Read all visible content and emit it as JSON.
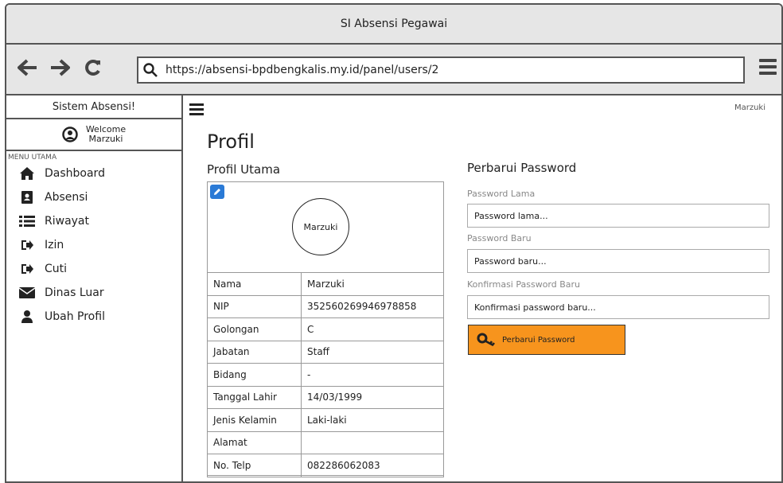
{
  "window": {
    "title": "SI Absensi Pegawai"
  },
  "browser": {
    "url": "https://absensi-bpdbengkalis.my.id/panel/users/2",
    "back_icon": "arrow-left-icon",
    "forward_icon": "arrow-right-icon",
    "reload_icon": "reload-icon",
    "search_icon": "search-icon",
    "menu_icon": "menu-icon"
  },
  "sidebar": {
    "app_name": "Sistem Absensi!",
    "welcome_line1": "Welcome",
    "welcome_line2": "Marzuki",
    "caption": "MENU UTAMA",
    "items": [
      {
        "label": "Dashboard",
        "icon": "home-icon"
      },
      {
        "label": "Absensi",
        "icon": "address-book-icon"
      },
      {
        "label": "Riwayat",
        "icon": "list-icon"
      },
      {
        "label": "Izin",
        "icon": "sign-in-icon"
      },
      {
        "label": "Cuti",
        "icon": "sign-in-icon"
      },
      {
        "label": "Dinas Luar",
        "icon": "envelope-icon"
      },
      {
        "label": "Ubah Profil",
        "icon": "user-icon"
      }
    ]
  },
  "header": {
    "user_name": "Marzuki"
  },
  "profile": {
    "page_title": "Profil",
    "section_title": "Profil Utama",
    "avatar_text": "Marzuki",
    "rows": [
      {
        "key": "Nama",
        "value": "Marzuki"
      },
      {
        "key": "NIP",
        "value": "352560269946978858"
      },
      {
        "key": "Golongan",
        "value": "C"
      },
      {
        "key": "Jabatan",
        "value": "Staff"
      },
      {
        "key": "Bidang",
        "value": "-"
      },
      {
        "key": "Tanggal Lahir",
        "value": "14/03/1999"
      },
      {
        "key": "Jenis Kelamin",
        "value": "Laki-laki"
      },
      {
        "key": "Alamat",
        "value": ""
      },
      {
        "key": "No. Telp",
        "value": "082286062083"
      }
    ]
  },
  "password": {
    "title": "Perbarui Password",
    "old_label": "Password Lama",
    "old_placeholder": "Password lama...",
    "new_label": "Password Baru",
    "new_placeholder": "Password baru...",
    "confirm_label": "Konfirmasi Password Baru",
    "confirm_placeholder": "Konfirmasi password baru...",
    "button_label": "Perbarui Password",
    "button_color": "#f7941d"
  }
}
